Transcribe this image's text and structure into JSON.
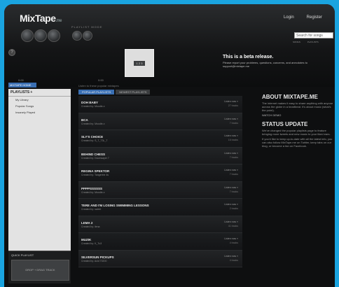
{
  "header": {
    "logo": "MixTape",
    "logo_suffix": ".me",
    "login": "Login",
    "register": "Register",
    "search_placeholder": "Search for songs",
    "search_opt1": "SONGS",
    "search_opt2": "PLAYLISTS",
    "ctrl_label": "PLAYLIST MODE",
    "time_left": "0:00",
    "time_right": "0:00",
    "player_label": "1 2 3",
    "info_icon": "?"
  },
  "beta": {
    "title": "This is a beta release.",
    "text": "Please report your problems, questions, concerns, and anecdotes to support@mixtape.me"
  },
  "sidebar": {
    "tab": "MIXTAPE HOME",
    "header": "PLAYLISTS +",
    "items": [
      {
        "label": "My Library"
      },
      {
        "label": "Popular Songs"
      },
      {
        "label": "Insanely Played"
      }
    ],
    "quick_title": "QUICK PLAYLIST",
    "quick_drop": "DROP + DRAG TRACK"
  },
  "center": {
    "caption": "Listen to these popular mixtapes",
    "tab_active": "POPULAR PLAYLISTS",
    "tab_other": "NEWEST PLAYLISTS",
    "rows": [
      {
        "title": "DOH BABY",
        "creator": "Created by: Moodle-x",
        "listen": "Listen now »",
        "songs": "27 tracks"
      },
      {
        "title": "BCA",
        "creator": "Created by: Moodle-x",
        "listen": "Listen now »",
        "songs": "7 tracks"
      },
      {
        "title": "SLY'S CHOICE",
        "creator": "Created by: S_T_T3L_T",
        "listen": "Listen now »",
        "songs": "16 tracks"
      },
      {
        "title": "BEHIND CHESS",
        "creator": "Created by: Doomsayer 7",
        "listen": "Listen now »",
        "songs": "7 tracks"
      },
      {
        "title": "REGINA SPEKTOR",
        "creator": "Created by: Tangerine 4s",
        "listen": "Listen now »",
        "songs": "7 tracks"
      },
      {
        "title": "PPPPSSSSSS",
        "creator": "Created by: Moodle-x",
        "listen": "Listen now »",
        "songs": "7 tracks"
      },
      {
        "title": "TERE AND I'M LOSING SWIMMING LESSONS",
        "creator": "Created by: sweet",
        "listen": "Listen now »",
        "songs": "2 tracks"
      },
      {
        "title": "LEMA 2",
        "creator": "Created by: ilena",
        "listen": "Listen now »",
        "songs": "41 tracks"
      },
      {
        "title": "MUZIK",
        "creator": "Created by: K_Tu3",
        "listen": "Listen now »",
        "songs": "4 tracks"
      },
      {
        "title": "SILVERSUN PICKUPS",
        "creator": "Created by: Acid 70200",
        "listen": "Listen now »",
        "songs": "4 tracks"
      }
    ]
  },
  "right": {
    "about_title": "ABOUT MIXTAPE.ME",
    "about_text": "The internet makes it easy to share anything with anyone across the globe in a heartbeat. It's about music (what's the point).",
    "watch_demo": "WATCH DEMO",
    "status_title": "STATUS UPDATE",
    "status_text1": "We've changed the popular playlists page to feature bringing more tweets and new music to your liked ears.",
    "status_text2": "If you'd like to keep up-to-date with all the latest info, you can also follow MixTape.me on Twitter, keep tabs on our blog, or become a fan on Facebook."
  }
}
